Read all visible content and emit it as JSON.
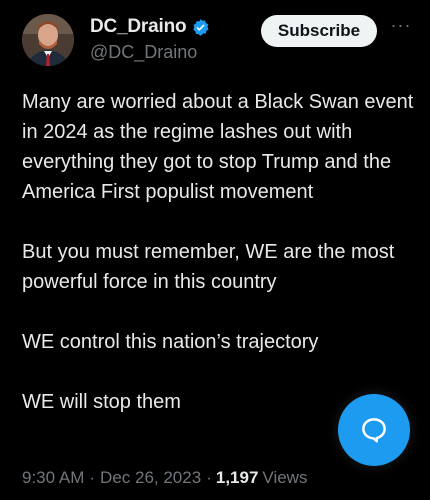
{
  "author": {
    "display_name": "DC_Draino",
    "handle": "@DC_Draino",
    "verified_icon": "verified-badge-icon"
  },
  "actions": {
    "subscribe_label": "Subscribe",
    "more_label": "···"
  },
  "tweet": {
    "paragraphs": [
      "Many are worried about a Black Swan event in 2024 as the regime lashes out with everything they got to stop Trump and the America First populist movement",
      "But you must remember, WE are the most powerful force in this country",
      "WE control this nation’s trajectory",
      "WE will stop them"
    ]
  },
  "meta": {
    "time": "9:30 AM",
    "separator": "·",
    "date": "Dec 26, 2023",
    "views_count": "1,197",
    "views_label": "Views"
  },
  "fab": {
    "icon": "compose-reply-icon"
  },
  "colors": {
    "background": "#000000",
    "text": "#e7e9ea",
    "secondary": "#71767b",
    "accent": "#1d9bf0"
  }
}
